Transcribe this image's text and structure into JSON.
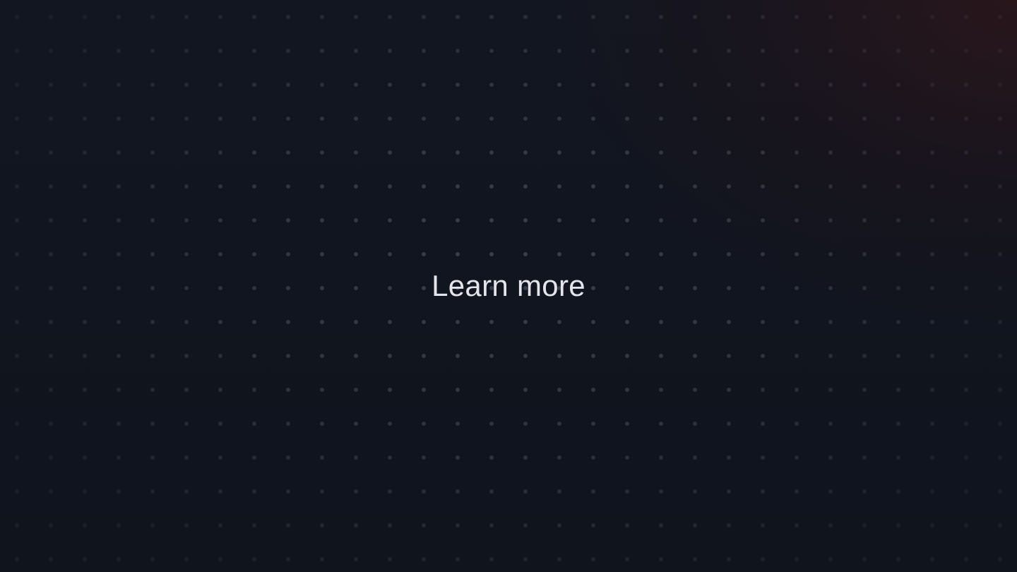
{
  "cta": {
    "label": "Learn more"
  },
  "colors": {
    "background": "#111520",
    "accent_glow": "#3a1616",
    "dot": "#5f6470",
    "text": "#e3e5ea"
  }
}
